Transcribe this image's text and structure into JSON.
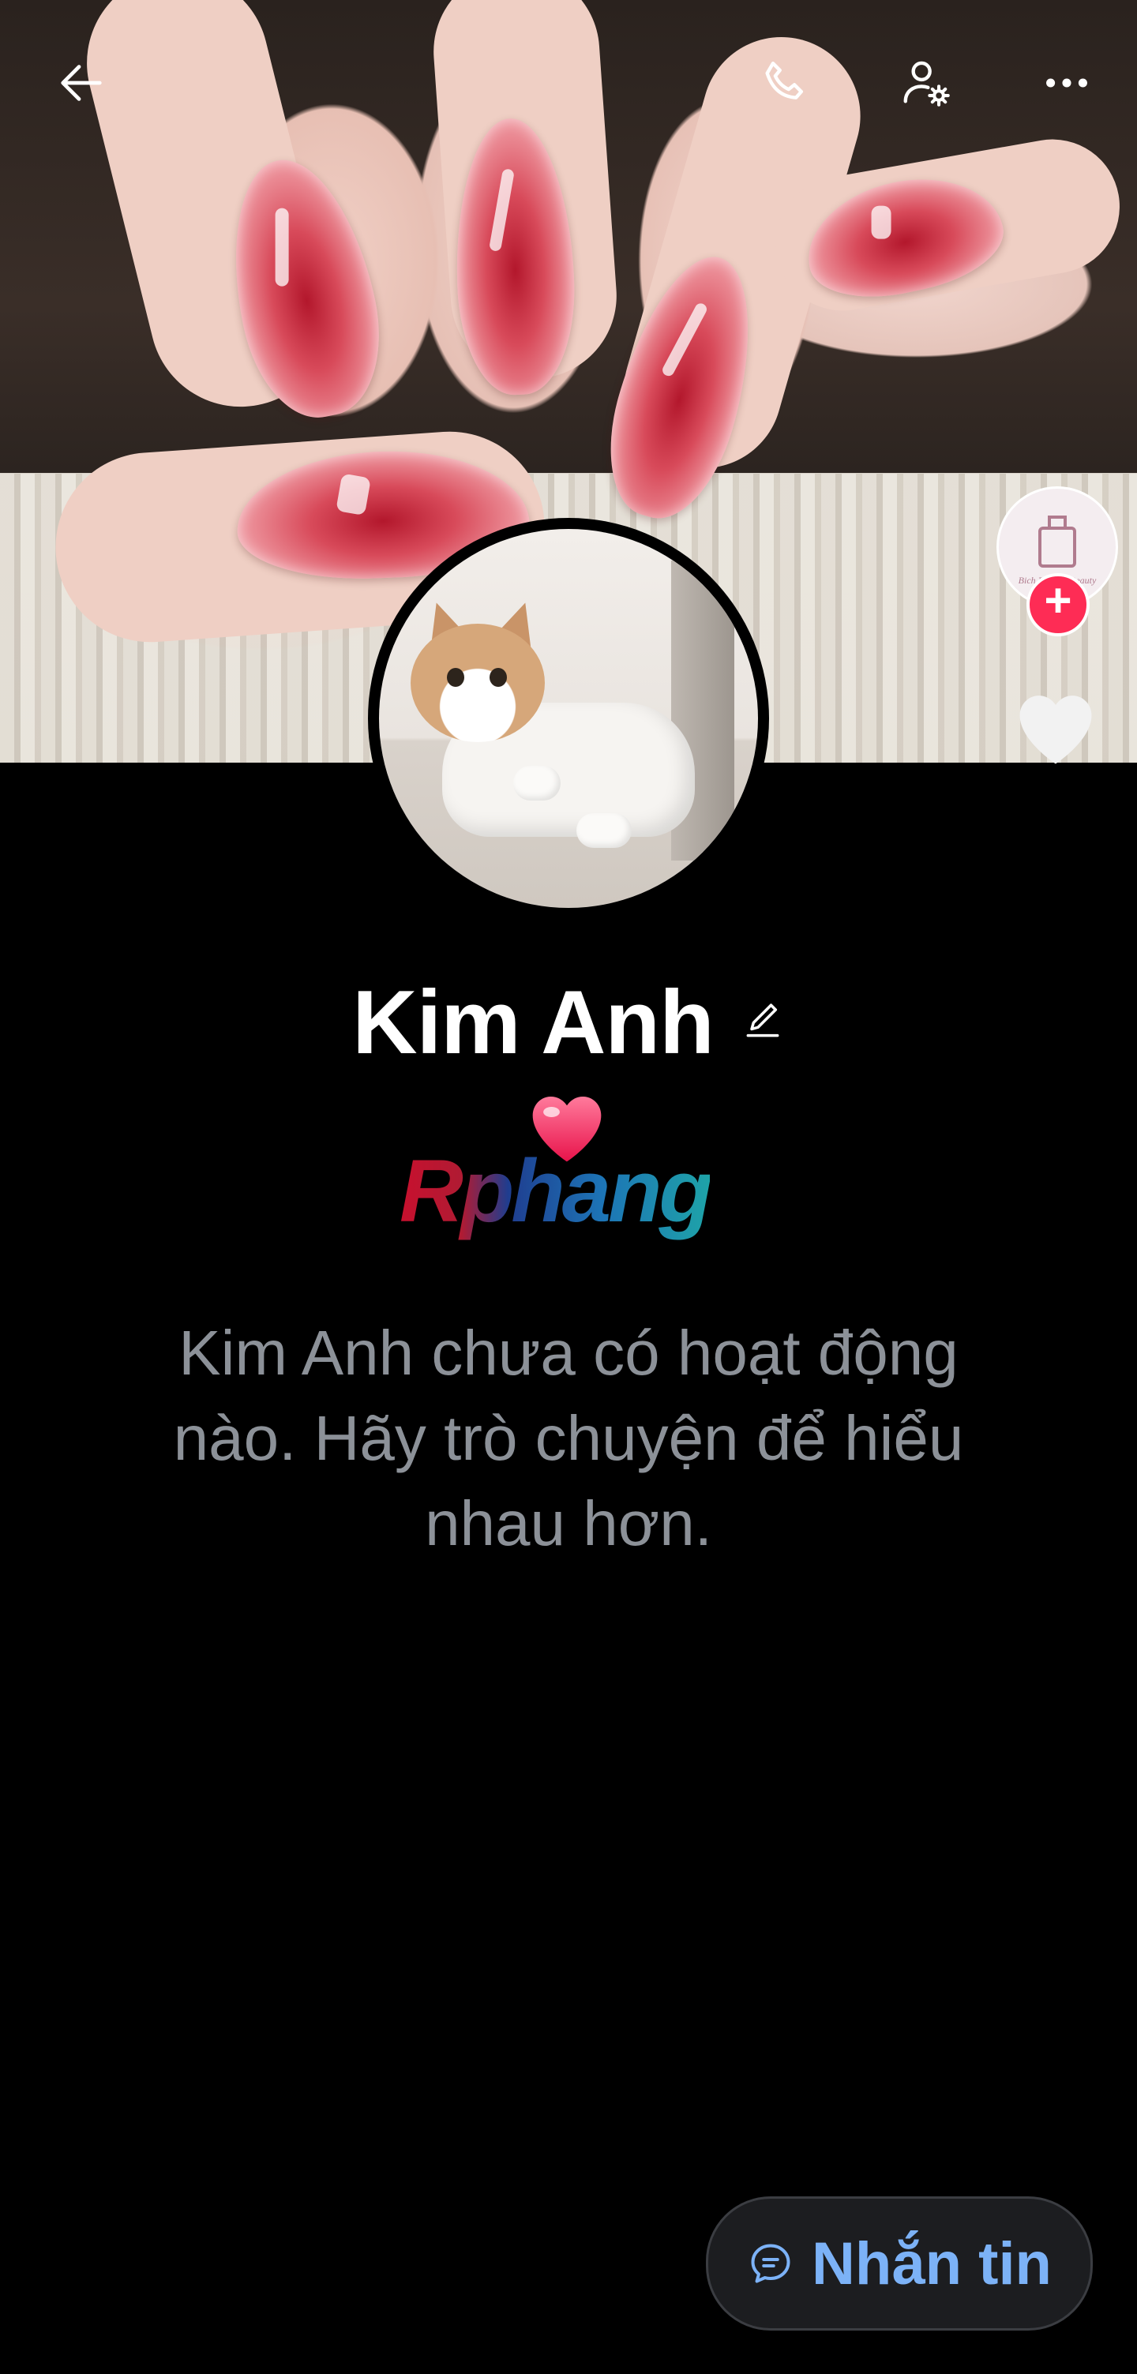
{
  "profile": {
    "name": "Kim Anh",
    "empty_message": "Kim Anh chưa có hoạt động nào. Hãy trò chuyện để hiểu nhau hơn."
  },
  "logo": {
    "text": "Rphang"
  },
  "shop_badge": {
    "brand": "Bich Phuong Beauty"
  },
  "actions": {
    "message_label": "Nhắn tin"
  },
  "icons": {
    "back": "back-arrow-icon",
    "call": "phone-icon",
    "settings": "user-settings-icon",
    "more": "more-dots-icon",
    "edit": "pencil-icon",
    "message": "chat-bubble-icon",
    "like": "heart-icon"
  },
  "colors": {
    "background": "#000000",
    "accent_blue": "#7cb2f7",
    "muted_text": "#8c9198",
    "plus_red": "#fe2c55"
  }
}
